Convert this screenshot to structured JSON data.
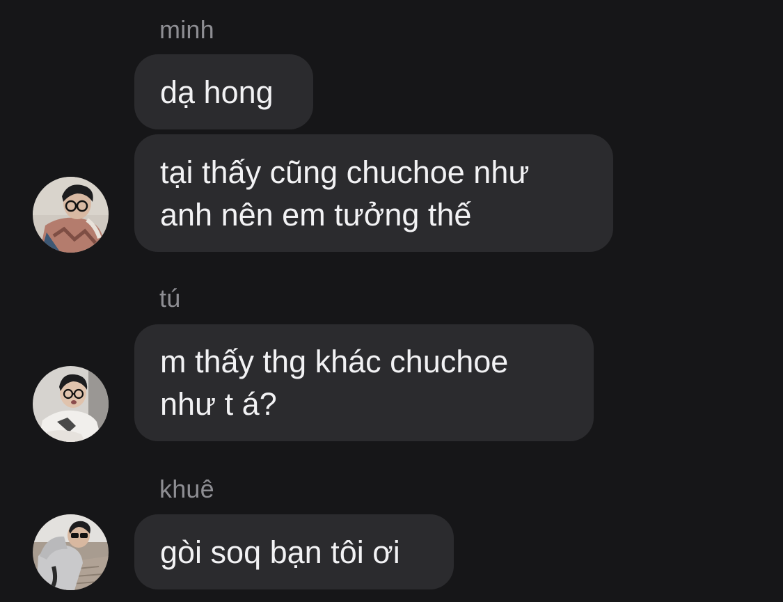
{
  "messages": [
    {
      "sender": "minh"
    },
    {
      "text": [
        "dạ hong"
      ]
    },
    {
      "text": [
        "tại thấy cũng chuchoe như",
        "anh nên em tưởng thế"
      ]
    },
    {
      "sender": "tú"
    },
    {
      "text": [
        "m thấy thg khác chuchoe",
        "như t á?"
      ]
    },
    {
      "sender": "khuê"
    },
    {
      "text": [
        "gòi soq bạn tôi ơi"
      ]
    }
  ],
  "colors": {
    "background": "#161618",
    "bubble": "#2b2b2e",
    "text": "#f2f2f4",
    "sender": "#8e8e93"
  }
}
